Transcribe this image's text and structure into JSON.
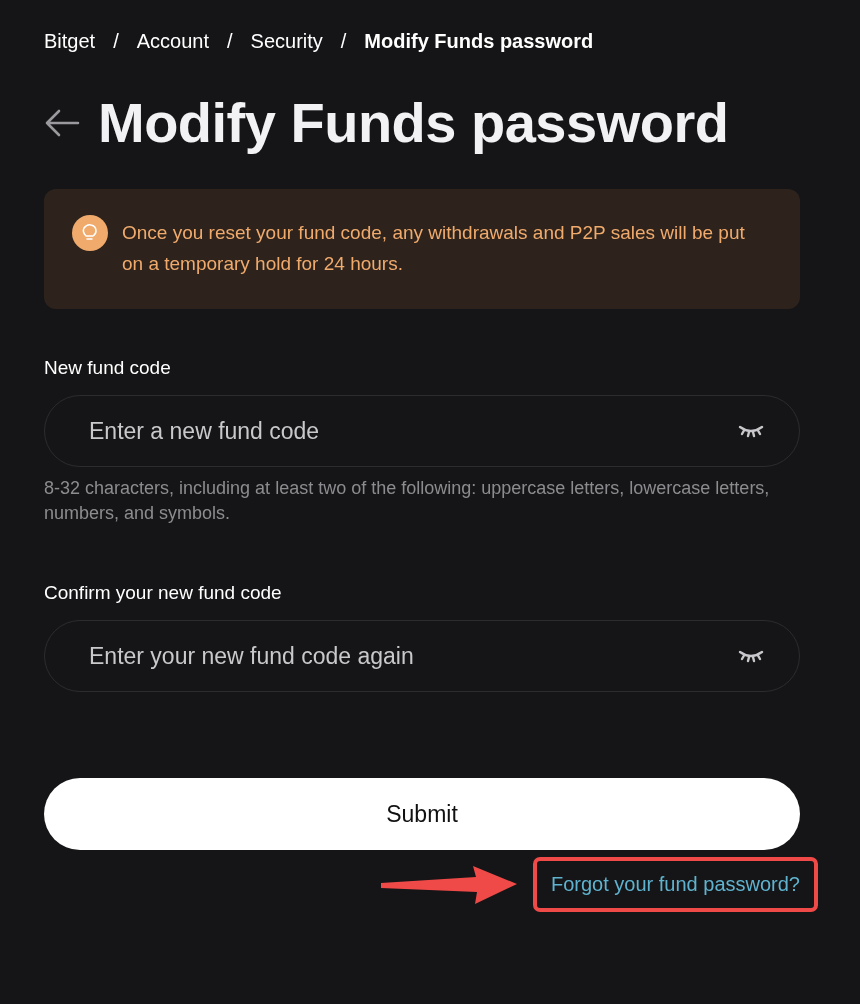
{
  "breadcrumb": [
    {
      "label": "Bitget",
      "current": false
    },
    {
      "label": "Account",
      "current": false
    },
    {
      "label": "Security",
      "current": false
    },
    {
      "label": "Modify Funds password",
      "current": true
    }
  ],
  "breadcrumb_separator": "/",
  "title": "Modify Funds password",
  "notice": {
    "text": "Once you reset your fund code, any withdrawals and P2P sales will be put on a temporary hold for 24 hours."
  },
  "fields": [
    {
      "label": "New fund code",
      "placeholder": "Enter a new fund code",
      "hint": "8-32 characters, including at least two of the following: uppercase letters, lowercase letters, numbers, and symbols."
    },
    {
      "label": "Confirm your new fund code",
      "placeholder": "Enter your new fund code again"
    }
  ],
  "submit": "Submit",
  "forgot_link": {
    "label": "Forgot your fund password?",
    "highlighted": true
  }
}
